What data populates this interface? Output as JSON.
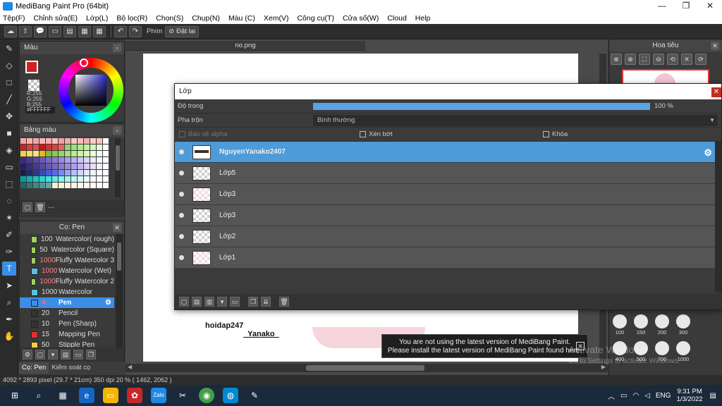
{
  "window": {
    "title": "MediBang Paint Pro (64bit)",
    "min": "—",
    "max": "❐",
    "close": "✕"
  },
  "menu": [
    "Tệp(F)",
    "Chỉnh sửa(E)",
    "Lớp(L)",
    "Bộ lọc(R)",
    "Chọn(S)",
    "Chụp(N)",
    "Màu (C)",
    "Xem(V)",
    "Công cụ(T)",
    "Cửa số(W)",
    "Cloud",
    "Help"
  ],
  "toolbar": {
    "shortcut_label": "Phím",
    "reset_label": "Đặt lại"
  },
  "color_panel": {
    "title": "Màu",
    "r": "R:255",
    "g": "G:255",
    "b": "B:255",
    "hex": "#FFFFFF",
    "fg_color": "#d32020"
  },
  "palette_panel": {
    "title": "Bảng màu",
    "foot_text": "---",
    "colors": [
      "#f4a6a6",
      "#f6b3b3",
      "#f4a6a6",
      "#f5b8b8",
      "#f3b0b0",
      "#f7c0c0",
      "#f2a0a0",
      "#f4aaaa",
      "#f8c8c8",
      "#f6bcbc",
      "#f4aeae",
      "#f8cccc",
      "#f6c0c0",
      "#fff",
      "#d62020",
      "#e03a3a",
      "#e64c4c",
      "#c81818",
      "#d83030",
      "#de4040",
      "#f06060",
      "#8ed66c",
      "#9ce07a",
      "#aeea8e",
      "#c0f0a0",
      "#d4f7b8",
      "#e8fbd8",
      "#fff",
      "#f4d03f",
      "#f6da60",
      "#f8e380",
      "#e8b820",
      "#76c043",
      "#84cc52",
      "#96d866",
      "#a8e07a",
      "#baeb90",
      "#cdf2a6",
      "#ddf8bf",
      "#eefbdd",
      "#f6fde9",
      "#fff",
      "#3a2a8a",
      "#4a3a9a",
      "#5a4aaa",
      "#6a5abb",
      "#7a6acc",
      "#8a7add",
      "#9a8aee",
      "#aaa0f0",
      "#bbb2f2",
      "#ccc4f4",
      "#ddd6f6",
      "#eee8f8",
      "#f6f3fc",
      "#fff",
      "#2a1a6a",
      "#3a2a7a",
      "#4a3a8a",
      "#5a4a9a",
      "#6a5aaa",
      "#7a6aba",
      "#8a7aca",
      "#9a8ada",
      "#b0a0ea",
      "#c4b6f0",
      "#d8ccf4",
      "#e8e0f8",
      "#f4f0fc",
      "#fff",
      "#1a1a4a",
      "#222a6a",
      "#2a3a8a",
      "#3a4aaa",
      "#4a5acc",
      "#5a6aee",
      "#7a88f4",
      "#98a6f8",
      "#b6c2fa",
      "#d0d8fc",
      "#e2e8fd",
      "#f0f4fe",
      "#f8fafe",
      "#fff",
      "#00a0a0",
      "#10b0b0",
      "#20c0c0",
      "#30d0d0",
      "#40e0e0",
      "#60e8e8",
      "#80f0f0",
      "#a0f4f4",
      "#c0f8f8",
      "#d8fafa",
      "#e8fcfc",
      "#f4fefe",
      "#fafefe",
      "#fff",
      "#1a6a6a",
      "#2a7a7a",
      "#3a8a8a",
      "#4a9a9a",
      "#5aaaaa",
      "#f4f0d0",
      "#f6f2d8",
      "#f8f4e0",
      "#faf6e8",
      "#fcf8ee",
      "#fdfaf3",
      "#fefcf7",
      "#fffefb",
      "#fff"
    ]
  },
  "brush_panel": {
    "title": "Cọ: Pen",
    "items": [
      {
        "size": "100",
        "name": "Watercolor( rough)",
        "chip": "#9ed45a",
        "red": false
      },
      {
        "size": "50",
        "name": "Watercolor (Square)",
        "chip": "#9ed45a",
        "red": false
      },
      {
        "size": "1000",
        "name": "Fluffy Watercolor 3",
        "chip": "#9ed45a",
        "red": true
      },
      {
        "size": "1000",
        "name": "Watercolor (Wet)",
        "chip": "#5bc0de",
        "red": true
      },
      {
        "size": "1000",
        "name": "Fluffy Watercolor 2",
        "chip": "#9ed45a",
        "red": true
      },
      {
        "size": "1000",
        "name": "Watercolor",
        "chip": "#5bc0de",
        "red": false
      },
      {
        "size": "4",
        "name": "Pen",
        "chip": "#3a8ee6",
        "red": true,
        "selected": true
      },
      {
        "size": "20",
        "name": "Pencil",
        "chip": "#333",
        "red": false
      },
      {
        "size": "10",
        "name": "Pen (Sharp)",
        "chip": "#333",
        "red": false
      },
      {
        "size": "15",
        "name": "Mapping Pen",
        "chip": "#e03030",
        "red": false
      },
      {
        "size": "50",
        "name": "Stipple Pen",
        "chip": "#f4d03f",
        "red": false
      }
    ],
    "gear": "⚙"
  },
  "left_tabs": [
    "Cọ: Pen",
    "Kiểm soát cọ"
  ],
  "canvas": {
    "doc_tab": "no.png",
    "handle1": "hoidap247",
    "handle2": "_Yanako_"
  },
  "navigator": {
    "title": "Hoa tiêu",
    "sizes": [
      "100",
      "150",
      "200",
      "300",
      "400",
      "500",
      "700",
      "1000"
    ]
  },
  "layer_dialog": {
    "title": "Lớp",
    "opacity_label": "Độ trong",
    "opacity_value": "100 %",
    "opacity_fraction": 1.0,
    "blend_label": "Pha trộn",
    "blend_value": "Bình thường",
    "protect_alpha": "Bảo vệ alpha",
    "clipping": "Xén bớt",
    "lock": "Khóa",
    "layers": [
      {
        "name": "NguyenYanako2407",
        "selected": true,
        "thumb": "ink"
      },
      {
        "name": "Lớp5",
        "selected": false,
        "thumb": "checker"
      },
      {
        "name": "Lớp3",
        "selected": false,
        "thumb": "pinkish"
      },
      {
        "name": "Lớp3",
        "selected": false,
        "thumb": "checker"
      },
      {
        "name": "Lớp2",
        "selected": false,
        "thumb": "checker"
      },
      {
        "name": "Lớp1",
        "selected": false,
        "thumb": "pinkish"
      }
    ]
  },
  "toast": {
    "line1": "You are not using the latest version of MediBang Paint.",
    "line2": "Please install the latest version of MediBang Paint found here."
  },
  "watermark": {
    "line1": "Activate Windows",
    "line2": "Go to Settings to activate Windows."
  },
  "status": "4092 * 2893 pixel  (29.7 * 21cm)  350 dpi  20 %  ( 1462, 2062 )",
  "taskbar": {
    "language": "ENG",
    "time": "9:31 PM",
    "date": "1/3/2022"
  }
}
